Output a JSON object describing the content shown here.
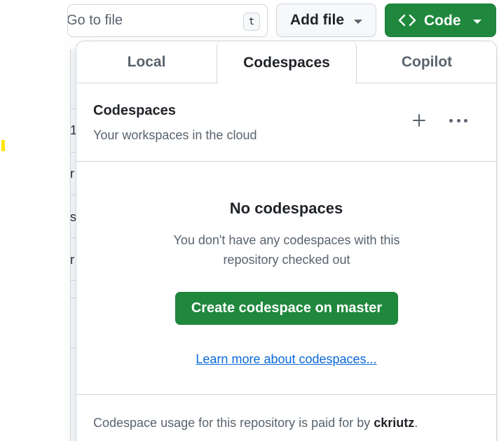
{
  "search": {
    "text": "Go to file",
    "shortcut": "t"
  },
  "toolbar": {
    "add_file_label": "Add file",
    "code_label": "Code"
  },
  "dropdown": {
    "tabs": [
      {
        "label": "Local"
      },
      {
        "label": "Codespaces"
      },
      {
        "label": "Copilot"
      }
    ],
    "active_tab": "Codespaces",
    "header": {
      "title": "Codespaces",
      "subtitle": "Your workspaces in the cloud"
    },
    "empty_state": {
      "title": "No codespaces",
      "description": "You don't have any codespaces with this repository checked out",
      "create_button": "Create codespace on master",
      "learn_more": "Learn more about codespaces..."
    },
    "footer": {
      "prefix": "Codespace usage for this repository is paid for by ",
      "user": "ckriutz",
      "suffix": "."
    }
  },
  "background": {
    "fragments": [
      "1",
      "r",
      "s",
      "r"
    ]
  },
  "colors": {
    "primary_green": "#1f883d",
    "link_blue": "#0969da",
    "muted": "#59636e",
    "border": "#d0d7de",
    "highlight_yellow": "#ffe500"
  },
  "icons": {
    "code": "code-brackets-icon",
    "plus": "plus-icon",
    "more": "kebab-horizontal-icon",
    "caret": "triangle-down-icon"
  }
}
